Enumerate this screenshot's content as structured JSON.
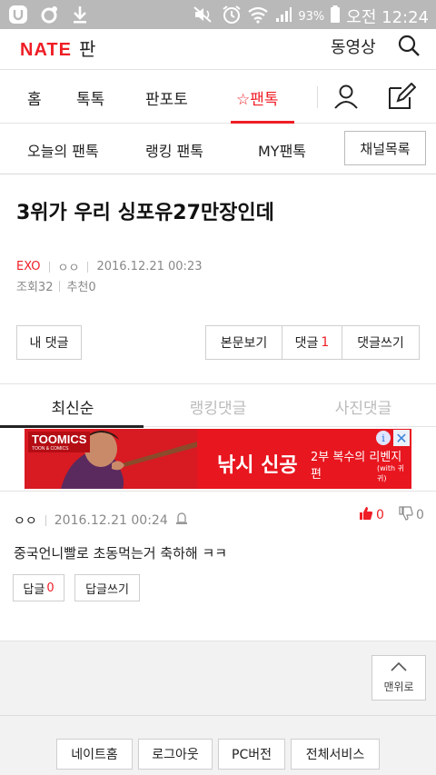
{
  "status_bar": {
    "battery": "93%",
    "time": "오전 12:24"
  },
  "header": {
    "logo_nate": "NATE",
    "logo_pan": "판",
    "video_label": "동영상"
  },
  "main_nav": {
    "items": [
      {
        "label": "홈"
      },
      {
        "label": "톡톡"
      },
      {
        "label": "판포토"
      },
      {
        "label": "☆팬톡",
        "active": true
      }
    ]
  },
  "sub_nav": {
    "items": [
      {
        "label": "오늘의 팬톡"
      },
      {
        "label": "랭킹 팬톡"
      },
      {
        "label": "MY팬톡"
      }
    ],
    "channel_button": "채널목록"
  },
  "post": {
    "title": "3위가 우리 싱포유27만장인데",
    "channel": "EXO",
    "author": "ㅇㅇ",
    "date": "2016.12.21 00:23",
    "views": "조회32",
    "recommend": "추천0"
  },
  "post_buttons": {
    "my_comment": "내 댓글",
    "view_body": "본문보기",
    "comment_label": "댓글",
    "comment_count": "1",
    "write_comment": "댓글쓰기"
  },
  "comment_tabs": [
    {
      "label": "최신순",
      "active": true
    },
    {
      "label": "랭킹댓글"
    },
    {
      "label": "사진댓글"
    }
  ],
  "ad": {
    "brand": "TOOMICS",
    "brand_sub": "TOON & COMICS",
    "title": "낚시 신공",
    "subtitle": "2부 복수의 리벤지편",
    "subtitle2": "(with 귀귀)"
  },
  "comments": [
    {
      "author": "ㅇㅇ",
      "date": "2016.12.21 00:24",
      "likes": "0",
      "dislikes": "0",
      "body": "중국언니빨로 초동먹는거 축하해 ㅋㅋ",
      "reply_label": "답글",
      "reply_count": "0",
      "reply_write": "답글쓰기"
    }
  ],
  "to_top": "맨위로",
  "footer_links": [
    {
      "label": "네이트홈"
    },
    {
      "label": "로그아웃"
    },
    {
      "label": "PC버전"
    },
    {
      "label": "전체서비스"
    }
  ],
  "colors": {
    "accent": "#ef1d25",
    "status_bar": "#b9b9b9",
    "footer_bg": "#f2f2f2"
  }
}
